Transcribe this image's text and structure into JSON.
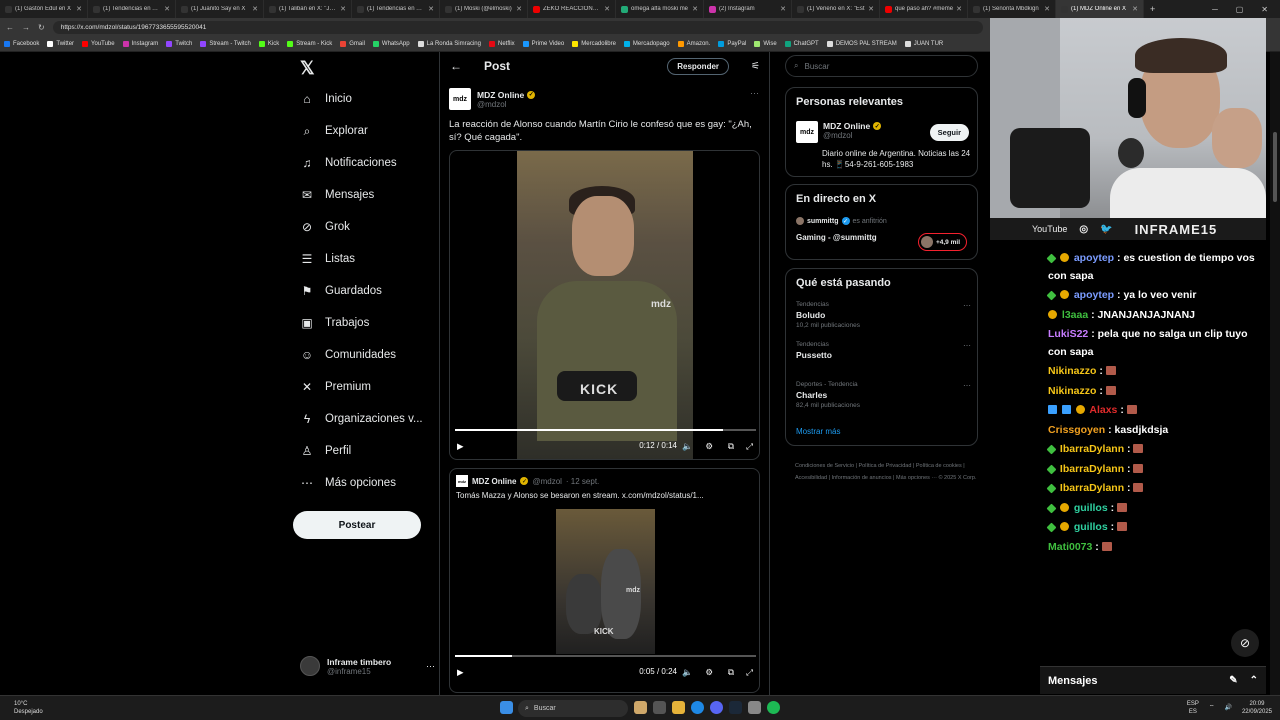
{
  "browser": {
    "tabs": [
      {
        "title": "(1) Gastón Edul en X",
        "color": "#333"
      },
      {
        "title": "(1) Tendencias en Arg",
        "color": "#333"
      },
      {
        "title": "(1) Juanito Say en X",
        "color": "#333"
      },
      {
        "title": "(1) Taliban en X: \"JAJA",
        "color": "#333"
      },
      {
        "title": "(1) Tendencias en Arg",
        "color": "#333"
      },
      {
        "title": "(1) Moski (@elmoski)",
        "color": "#333"
      },
      {
        "title": "ZEKO REACCIONA AL",
        "color": "#e00"
      },
      {
        "title": "omega alfa moski me",
        "color": "#2a7"
      },
      {
        "title": "(2) Instagram",
        "color": "#c3a"
      },
      {
        "title": "(1) Veneno en X: \"Est",
        "color": "#333"
      },
      {
        "title": "que paso ah? #meme",
        "color": "#e00"
      },
      {
        "title": "(1) Señorita Mbdkign",
        "color": "#333"
      },
      {
        "title": "(1) MDZ Online en X",
        "color": "#333",
        "active": true
      }
    ],
    "url": "https://x.com/mdzol/status/1967733655595520041",
    "bookmarks": [
      "Facebook",
      "Twitter",
      "YouTube",
      "Instagram",
      "Twitch",
      "Stream - Twitch",
      "Kick",
      "Stream - Kick",
      "Gmail",
      "WhatsApp",
      "La Ronda Simracing",
      "Netflix",
      "Prime Video",
      "Mercadolibre",
      "Mercadopago",
      "Amazon.",
      "PayPal",
      "Wise",
      "ChatGPT",
      "DEMOS PAL STREAM",
      "JUAN TUR"
    ]
  },
  "nav": {
    "items": [
      {
        "label": "Inicio",
        "icon": "⌂"
      },
      {
        "label": "Explorar",
        "icon": "⌕"
      },
      {
        "label": "Notificaciones",
        "icon": "♫"
      },
      {
        "label": "Mensajes",
        "icon": "✉"
      },
      {
        "label": "Grok",
        "icon": "⊘"
      },
      {
        "label": "Listas",
        "icon": "☰"
      },
      {
        "label": "Guardados",
        "icon": "⚑"
      },
      {
        "label": "Trabajos",
        "icon": "▣"
      },
      {
        "label": "Comunidades",
        "icon": "☺"
      },
      {
        "label": "Premium",
        "icon": "✕"
      },
      {
        "label": "Organizaciones v...",
        "icon": "ϟ"
      },
      {
        "label": "Perfil",
        "icon": "♙"
      },
      {
        "label": "Más opciones",
        "icon": "⋯"
      }
    ],
    "post_label": "Postear",
    "account": {
      "name": "Inframe timbero",
      "handle": "@inframe15"
    }
  },
  "main": {
    "title": "Post",
    "reply_label": "Responder",
    "author": {
      "name": "MDZ Online",
      "handle": "@mdzol",
      "logo": "mdz"
    },
    "text": "La reacción de Alonso cuando Martín Cirio le confesó que es gay: \"¿Ah, sí? Qué cagada\".",
    "video": {
      "time": "0:12 / 0:14",
      "progress": 0.89,
      "watermark_kick": "KICK",
      "watermark_mdz": "mdz"
    },
    "quote": {
      "name": "MDZ Online",
      "handle": "@mdzol",
      "date": "· 12 sept.",
      "text": "Tomás Mazza y Alonso se besaron en stream. x.com/mdzol/status/1...",
      "time": "0:05 / 0:24",
      "progress": 0.19
    }
  },
  "right": {
    "search_placeholder": "Buscar",
    "relevant": {
      "title": "Personas relevantes",
      "name": "MDZ Online",
      "handle": "@mdzol",
      "follow_label": "Seguir",
      "bio": "Diario online de Argentina. Noticias las 24 hs. 📱54-9-261-605-1983"
    },
    "live": {
      "title": "En directo en X",
      "user": "summittg",
      "role": "es anfitrión",
      "stream": "Gaming - @summittg",
      "count": "+4,9 mil"
    },
    "trends": {
      "title": "Qué está pasando",
      "items": [
        {
          "context": "Tendencias",
          "name": "Boludo",
          "posts": "10,2 mil publicaciones"
        },
        {
          "context": "Tendencias",
          "name": "Pussetto",
          "posts": ""
        },
        {
          "context": "Deportes - Tendencia",
          "name": "Charles",
          "posts": "82,4 mil publicaciones"
        }
      ],
      "show_more": "Mostrar más"
    },
    "footer": "Condiciones de Servicio  |  Política de Privacidad  |  Política de cookies  |  Accesibilidad  |  Información de anuncios  |  Más opciones ···  © 2025 X Corp."
  },
  "stream": {
    "youtube": "YouTube",
    "brand": "INFRAME15",
    "chat": [
      {
        "badges": [
          "green",
          "gold"
        ],
        "user": "apoytep",
        "color": "#7b9cff",
        "text": "es cuestion de tiempo vos con sapa"
      },
      {
        "badges": [
          "green",
          "gold"
        ],
        "user": "apoytep",
        "color": "#7b9cff",
        "text": "ya lo veo venir"
      },
      {
        "badges": [
          "gold"
        ],
        "user": "l3aaa",
        "color": "#3fbf3f",
        "text": "JNANJANJAJNANJ"
      },
      {
        "badges": [],
        "user": "LukiS22",
        "color": "#c77dff",
        "text": "pela que no salga un clip tuyo con sapa"
      },
      {
        "badges": [],
        "user": "Nikinazzo",
        "color": "#f5c518",
        "text": "",
        "emote": true
      },
      {
        "badges": [],
        "user": "Nikinazzo",
        "color": "#f5c518",
        "text": "",
        "emote": true
      },
      {
        "badges": [
          "blue",
          "blue",
          "gold"
        ],
        "user": "Alaxs",
        "color": "#e02b2b",
        "text": "",
        "emote": true
      },
      {
        "badges": [],
        "user": "Crissgoyen",
        "color": "#f0a020",
        "text": "kasdjkdsja"
      },
      {
        "badges": [
          "green"
        ],
        "user": "IbarraDylann",
        "color": "#f5c518",
        "text": "",
        "emote": true
      },
      {
        "badges": [
          "green"
        ],
        "user": "IbarraDylann",
        "color": "#f5c518",
        "text": "",
        "emote": true
      },
      {
        "badges": [
          "green"
        ],
        "user": "IbarraDylann",
        "color": "#f5c518",
        "text": "",
        "emote": true
      },
      {
        "badges": [
          "green",
          "gold"
        ],
        "user": "guillos",
        "color": "#2fd0a0",
        "text": "",
        "emote": true
      },
      {
        "badges": [
          "green",
          "gold"
        ],
        "user": "guillos",
        "color": "#2fd0a0",
        "text": "",
        "emote": true
      },
      {
        "badges": [],
        "user": "Mati0073",
        "color": "#3fbf3f",
        "text": "",
        "emote": true
      }
    ],
    "chat_footer": "Mensajes"
  },
  "taskbar": {
    "temp": "10°C",
    "weather": "Despejado",
    "search": "Buscar",
    "lang": "ESP",
    "lang2": "ES",
    "time": "20:09",
    "date": "22/09/2025"
  }
}
